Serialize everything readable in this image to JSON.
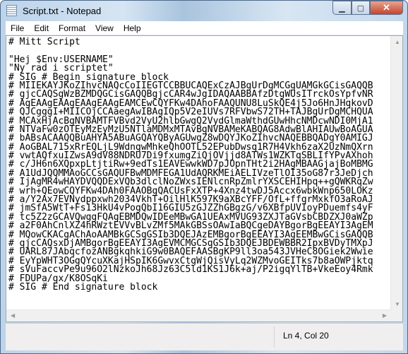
{
  "window": {
    "title": "Script.txt - Notepad"
  },
  "menu": [
    "File",
    "Edit",
    "Format",
    "View",
    "Help"
  ],
  "document": {
    "lines": [
      "# Mitt Script",
      "",
      "\"Hej $Env:USERNAME\"",
      "\"Ny rad i scriptet\"",
      "# SIG # Begin signature block",
      "# MIIEKAYJKoZIhvcNAQcCoIIEGTCCBBUCAQExCzAJBgUrDgMCGgUAMGkGCisGAQQB",
      "# gjcCAQSgWzBZMDQGCisGAQQBgjcCAR4wJgIDAQAABBAfzDtgWUsITrckOsYpfvNR",
      "# AgEAAgEAAgEAAgEAAgEAMCEwCQYFKw4DAhoFAAQUNU8LuSkQE4j5Jo6HnJHqkovD",
      "# QJCgggI+MIICOjCCAaegAwIBAgIQp5V2eIUVs7RFVbwS72TH+TAJBgUrDgMCHQUA",
      "# MCAxHjAcBgNVBAMTFVBvd2VyU2hlbGwgQ2VydGlmaWthdGUwHhcNMDcwNDI0MjA1",
      "# NTVaFw0zOTEyMzEyMzU5NTlaMDMxMTAvBgNVBAMeKABQAG8AdwBlAHIAUwBoAGUA",
      "# bABsACAAQQBuAHYA5ABuAGQAYQByAGUwgZ8wDQYJKoZIhvcNAQEBBQADgY0AMIGJ",
      "# AoGBAL715xRrEQLjL9WdngwMhkeQhOOTL52EPubDwsq1R7H4Vkh6zaX2UzNmQXrn",
      "# vwtAQfxuIZwsA9dV88NDRU7Di9fxumgZiQjOVjjd8ATWs1WZKTqSBLIfYPvAXhoh",
      "# c/JH6n6XQpxpLtjtiRw+9edTs1EAVEwwkWD7pJOpnTHt2i2HAgMBAAGjajBoMBMG",
      "# A1UdJQQMMAoGCCsGAQUFBwMDMFEGA1UdAQRKMEiAELIVzeTlOI35oG87r3JeDjch",
      "# IjAgMR4wHAYDVQQDExVQb3dlclNoZWxsIENlcnRpZmlrYXSCEHIHpq++gQWKRqZw",
      "# wrh+QEowCQYFKw4DAh0FAAOBgQACUsFxXTP+4Xnz4twDJ5Accx6wbkWnp650LOKz",
      "# a/Y2Ax7EVNydppxwh2034VkhT+OilHlK597K9aXBcYFF/OfL+ffgrMxkfO3aRoAJ",
      "# jmSfA5WtT+Fs13HkU4vPogQbI16GIU5zGJZZhGBgzG/v6XBfpUVIoyPDuemfs4yF",
      "# tc5Z2zGCAVQwggFQAgEBMDQwIDEeMBwGA1UEAxMVUG93ZXJTaGVsbCBDZXJ0aWZp",
      "# a2F0AhCnlXZ4hRWztEVVvBLvZMf5MAkGBSsOAwIaBQCgeDAYBgorBgEEAYI3AgEM",
      "# MQowCKACgAChAoAAMBkGCSqGSIb3DQEJAzEMBgorBgEEAYI3AgEEMBwGCisGAQQB",
      "# gjcCAQsxDjAMBgorBgEEAYI3AgEVMCMGCSqGSIb3DQEJBDEWBBR2IpxBVDyTMXpJ",
      "# UARL87JAbqcfozANBgkqhkiG9w0BAQEFAASBgKP9ll3oa543JVHeC8OGiek2Wwie",
      "# EyYpWHT3OGgQYcuXKajHSpIK6GwvxCtgWjQisVyLq2WZMvoGEITks7b8aOWPjktq",
      "# sVuFaccvPe9u96O2lNzkoJh68Jz63C5ld1KS1J6k+aj/P2igqYlTB+VkeEoy4Rmk",
      "# FDUPa/gx/K8OSqKi",
      "# SIG # End signature block"
    ]
  },
  "status": {
    "position": "Ln 4, Col 20"
  }
}
